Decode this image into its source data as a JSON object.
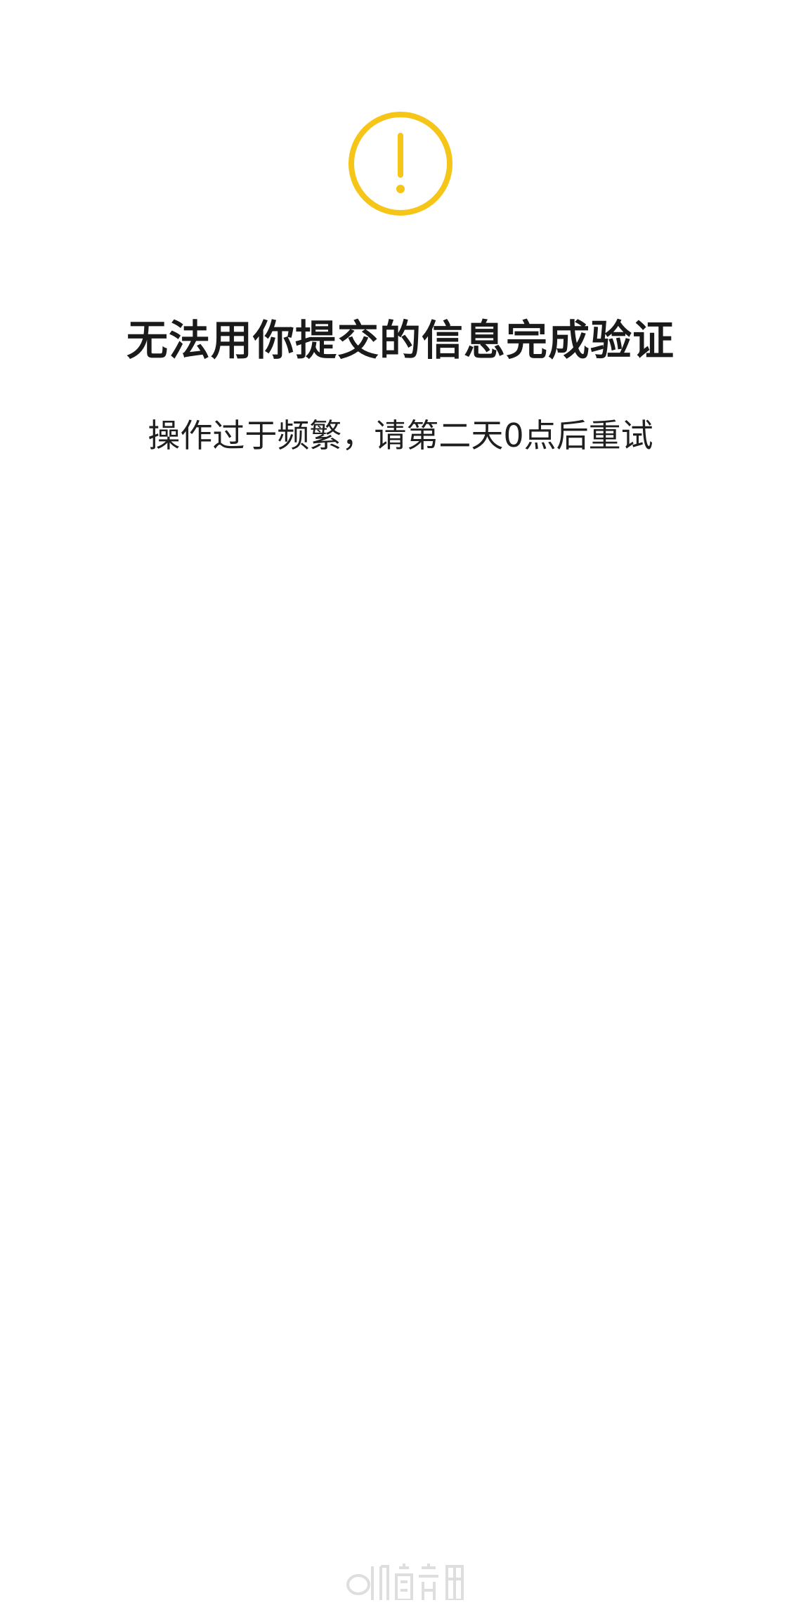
{
  "dialog": {
    "icon": "exclamation-circle-icon",
    "title": "无法用你提交的信息完成验证",
    "message": "操作过于频繁，请第二天0点后重试"
  },
  "colors": {
    "background": "#ffffff",
    "warning_accent": "#f5c518",
    "title_text": "#1a1a1a",
    "message_text": "#1f1f1f"
  }
}
